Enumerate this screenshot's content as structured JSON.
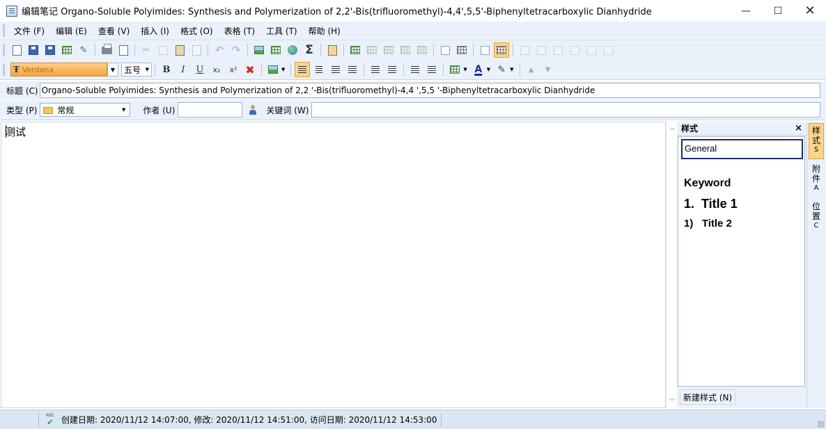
{
  "window": {
    "title": "编辑笔记 Organo-Soluble Polyimides:  Synthesis and Polymerization of 2,2'-Bis(trifluoromethyl)-4,4',5,5'-Biphenyltetracarboxylic Dianhydride",
    "minimize": "—",
    "maximize": "☐",
    "close": "✕"
  },
  "menu": {
    "items": [
      "文件 (F)",
      "编辑 (E)",
      "查看 (V)",
      "插入 (I)",
      "格式 (O)",
      "表格 (T)",
      "工具 (T)",
      "帮助 (H)"
    ]
  },
  "format_toolbar": {
    "font_name": "Verdana",
    "font_size": "五号",
    "bold": "B",
    "italic": "I",
    "underline": "U",
    "subscript": "x₂",
    "superscript": "x²",
    "font_color_glyph": "A"
  },
  "fields": {
    "title_label": "标题 (C)",
    "title_value": "Organo-Soluble Polyimides:  Synthesis and Polymerization of 2,2   '-Bis(trifluoromethyl)-4,4   ',5,5   '-Biphenyltetracarboxylic Dianhydride",
    "type_label": "类型 (P)",
    "type_value": "常规",
    "author_label": "作者 (U)",
    "author_value": "",
    "keywords_label": "关键词 (W)",
    "keywords_value": ""
  },
  "editor": {
    "content": "测试"
  },
  "style_panel": {
    "header": "样式",
    "close": "×",
    "items": [
      "General",
      "Keyword",
      "1.  Title 1",
      "1)   Title 2"
    ],
    "new_style_button": "新建样式 (N)"
  },
  "side_tabs": [
    {
      "label_1": "样",
      "label_2": "式",
      "key": "S"
    },
    {
      "label_1": "附",
      "label_2": "件",
      "key": "A"
    },
    {
      "label_1": "位",
      "label_2": "置",
      "key": "C"
    }
  ],
  "status": {
    "spell_icon_text": "ABC",
    "text": "创建日期: 2020/11/12 14:07:00, 修改: 2020/11/12 14:51:00, 访问日期: 2020/11/12 14:53:00"
  }
}
